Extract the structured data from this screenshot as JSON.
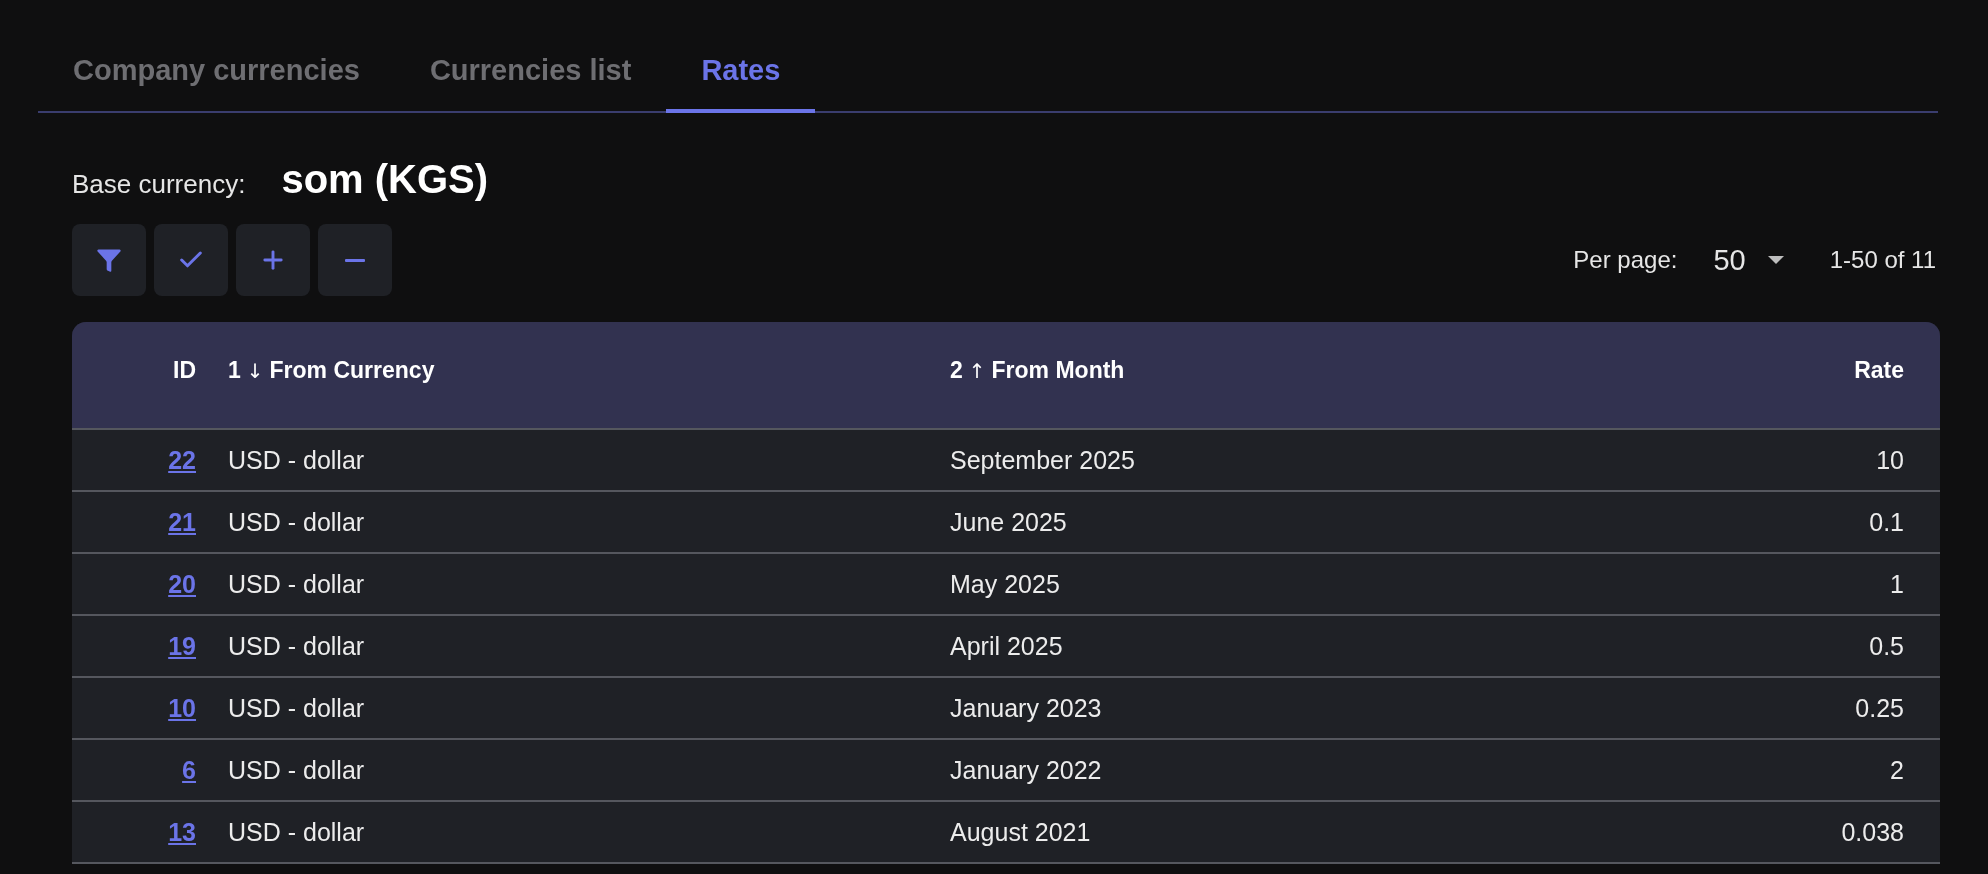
{
  "tabs": [
    {
      "label": "Company currencies",
      "selected": false
    },
    {
      "label": "Currencies list",
      "selected": false
    },
    {
      "label": "Rates",
      "selected": true
    }
  ],
  "base_currency": {
    "label": "Base currency:",
    "value": "som (KGS)"
  },
  "toolbar": [
    {
      "kind": "filter"
    },
    {
      "kind": "check"
    },
    {
      "kind": "add"
    },
    {
      "kind": "remove"
    }
  ],
  "pagination": {
    "label": "Per page:",
    "per_page": "50",
    "range": "1-50 of 11"
  },
  "table": {
    "columns": [
      {
        "label": "ID"
      },
      {
        "label": "From Currency",
        "sort_index": "1",
        "sort_arrow": "↓"
      },
      {
        "label": "From Month",
        "sort_index": "2",
        "sort_arrow": "↑"
      },
      {
        "label": "Rate"
      }
    ],
    "rows": [
      [
        "22",
        "USD - dollar",
        "September 2025",
        "10"
      ],
      [
        "21",
        "USD - dollar",
        "June 2025",
        "0.1"
      ],
      [
        "20",
        "USD - dollar",
        "May 2025",
        "1"
      ],
      [
        "19",
        "USD - dollar",
        "April 2025",
        "0.5"
      ],
      [
        "10",
        "USD - dollar",
        "January 2023",
        "0.25"
      ],
      [
        "6",
        "USD - dollar",
        "January 2022",
        "2"
      ],
      [
        "13",
        "USD - dollar",
        "August 2021",
        "0.038"
      ]
    ]
  }
}
